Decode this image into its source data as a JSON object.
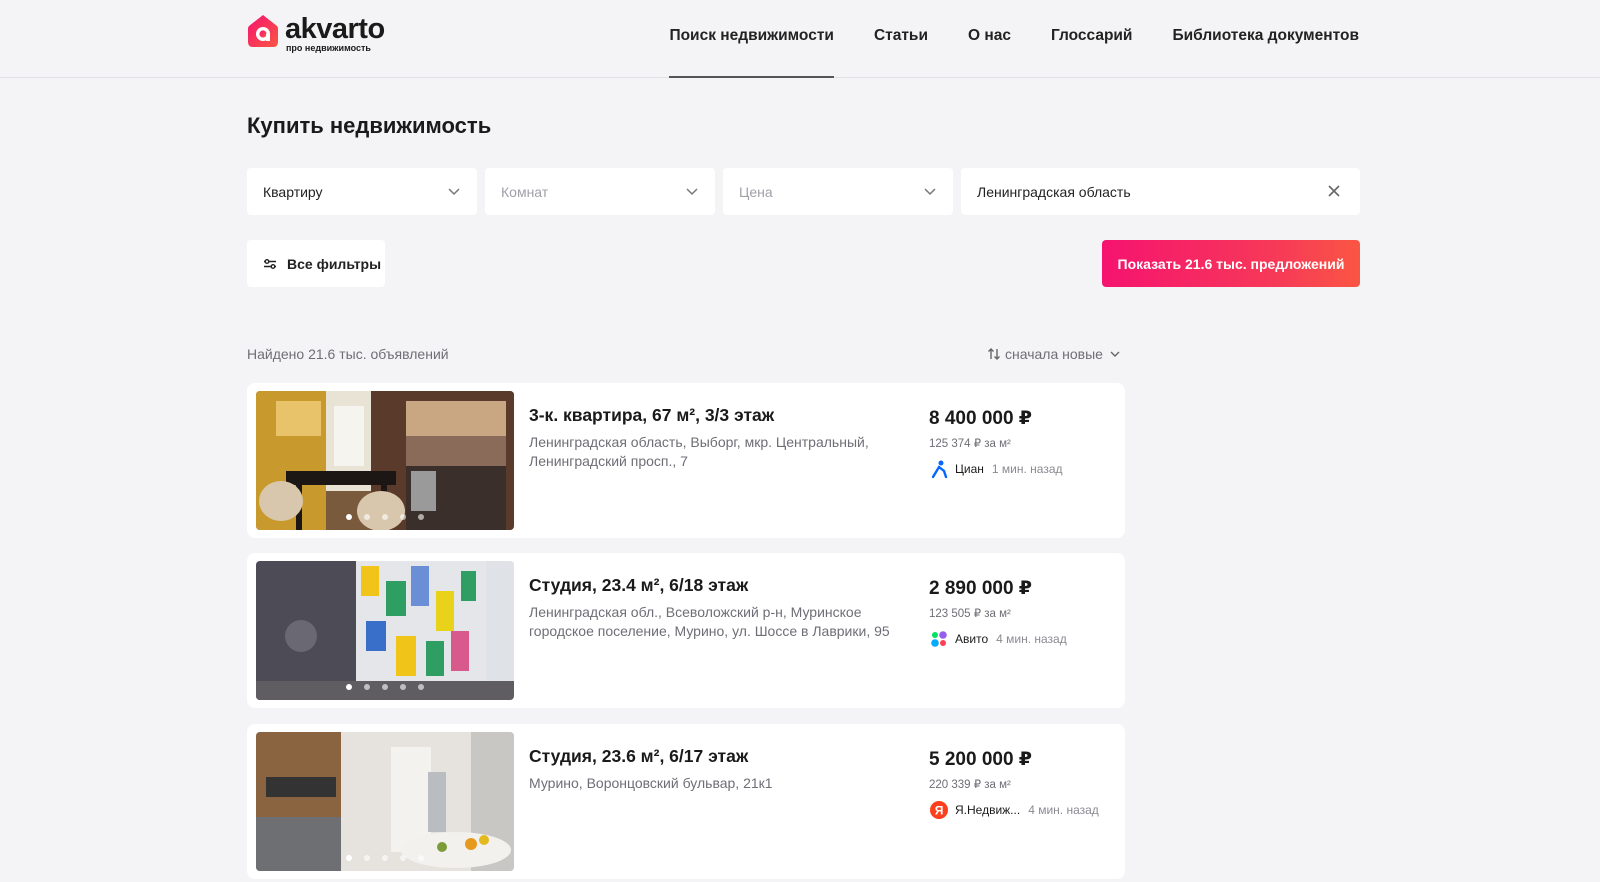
{
  "brand": {
    "name": "akvarto",
    "tagline": "про недвижимость",
    "accent": "#f5136f"
  },
  "nav": {
    "items": [
      {
        "label": "Поиск недвижимости",
        "active": true
      },
      {
        "label": "Статьи",
        "active": false
      },
      {
        "label": "О нас",
        "active": false
      },
      {
        "label": "Глоссарий",
        "active": false
      },
      {
        "label": "Библиотека документов",
        "active": false
      }
    ]
  },
  "page": {
    "title": "Купить недвижимость"
  },
  "filters": {
    "type": {
      "value": "Квартиру",
      "icon": "chevron-down-icon"
    },
    "rooms": {
      "placeholder": "Комнат",
      "icon": "chevron-down-icon"
    },
    "price": {
      "placeholder": "Цена",
      "icon": "chevron-down-icon"
    },
    "region": {
      "value": "Ленинградская область",
      "icon": "close-icon"
    },
    "all_filters_label": "Все фильтры",
    "show_button_label": "Показать 21.6 тыс. предложений"
  },
  "results": {
    "found_text": "Найдено 21.6 тыс. объявлений",
    "sort_label": "сначала новые"
  },
  "listings": [
    {
      "title": "3-к. квартира, 67 м², 3/3 этаж",
      "address": "Ленинградская область, Выборг, мкр. Центральный, Ленинградский просп., 7",
      "price": "8 400 000 ₽",
      "price_per_m2": "125 374 ₽ за м²",
      "source": "Циан",
      "source_icon": "cian-logo-icon",
      "time": "1 мин. назад",
      "photo_dots": 5,
      "active_dot": 0
    },
    {
      "title": "Студия, 23.4 м², 6/18 этаж",
      "address": "Ленинградская обл., Всеволожский р-н, Муринское городское поселение, Мурино, ул. Шоссе в Лаврики, 95",
      "price": "2 890 000 ₽",
      "price_per_m2": "123 505 ₽ за м²",
      "source": "Авито",
      "source_icon": "avito-logo-icon",
      "time": "4 мин. назад",
      "photo_dots": 5,
      "active_dot": 0
    },
    {
      "title": "Студия, 23.6 м², 6/17 этаж",
      "address": "Мурино, Воронцовский бульвар, 21к1",
      "price": "5 200 000 ₽",
      "price_per_m2": "220 339 ₽ за м²",
      "source": "Я.Недвиж...",
      "source_icon": "yandex-realty-logo-icon",
      "time": "4 мин. назад",
      "photo_dots": 5,
      "active_dot": 0
    }
  ]
}
